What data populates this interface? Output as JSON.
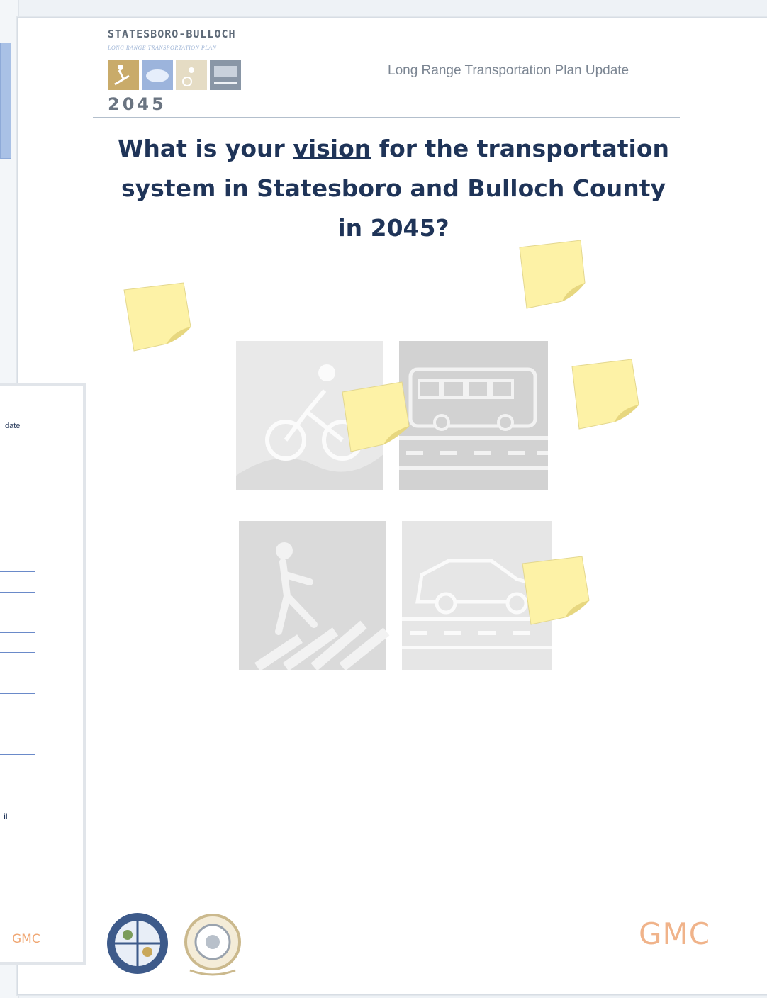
{
  "header": {
    "logo_title": "STATESBORO-BULLOCH",
    "logo_subtitle": "LONG RANGE TRANSPORTATION PLAN",
    "logo_year": "2045",
    "title": "Long Range Transportation Plan Update"
  },
  "question": {
    "before": "What is your ",
    "emphasis": "vision",
    "after": " for the transportation",
    "line2": "system in Statesboro and Bulloch County",
    "line3": "in 2045?"
  },
  "pictograms": [
    "bicycle-icon",
    "bus-icon",
    "pedestrian-icon",
    "car-icon"
  ],
  "sticky_notes": [
    "sticky-note-1",
    "sticky-note-2",
    "sticky-note-3",
    "sticky-note-4",
    "sticky-note-5"
  ],
  "footer": {
    "gmc_logo": "GMC",
    "seals": [
      "county-seal-icon",
      "city-seal-icon"
    ]
  },
  "back_page": {
    "header_fragment": "date",
    "small_label": "il",
    "gmc_logo": "GMC"
  },
  "colors": {
    "title_blue": "#1f3458",
    "sticky_yellow": "#fdf2a6",
    "gmc_orange": "#f0b38a",
    "picto_gray": "#d6d6d6"
  }
}
